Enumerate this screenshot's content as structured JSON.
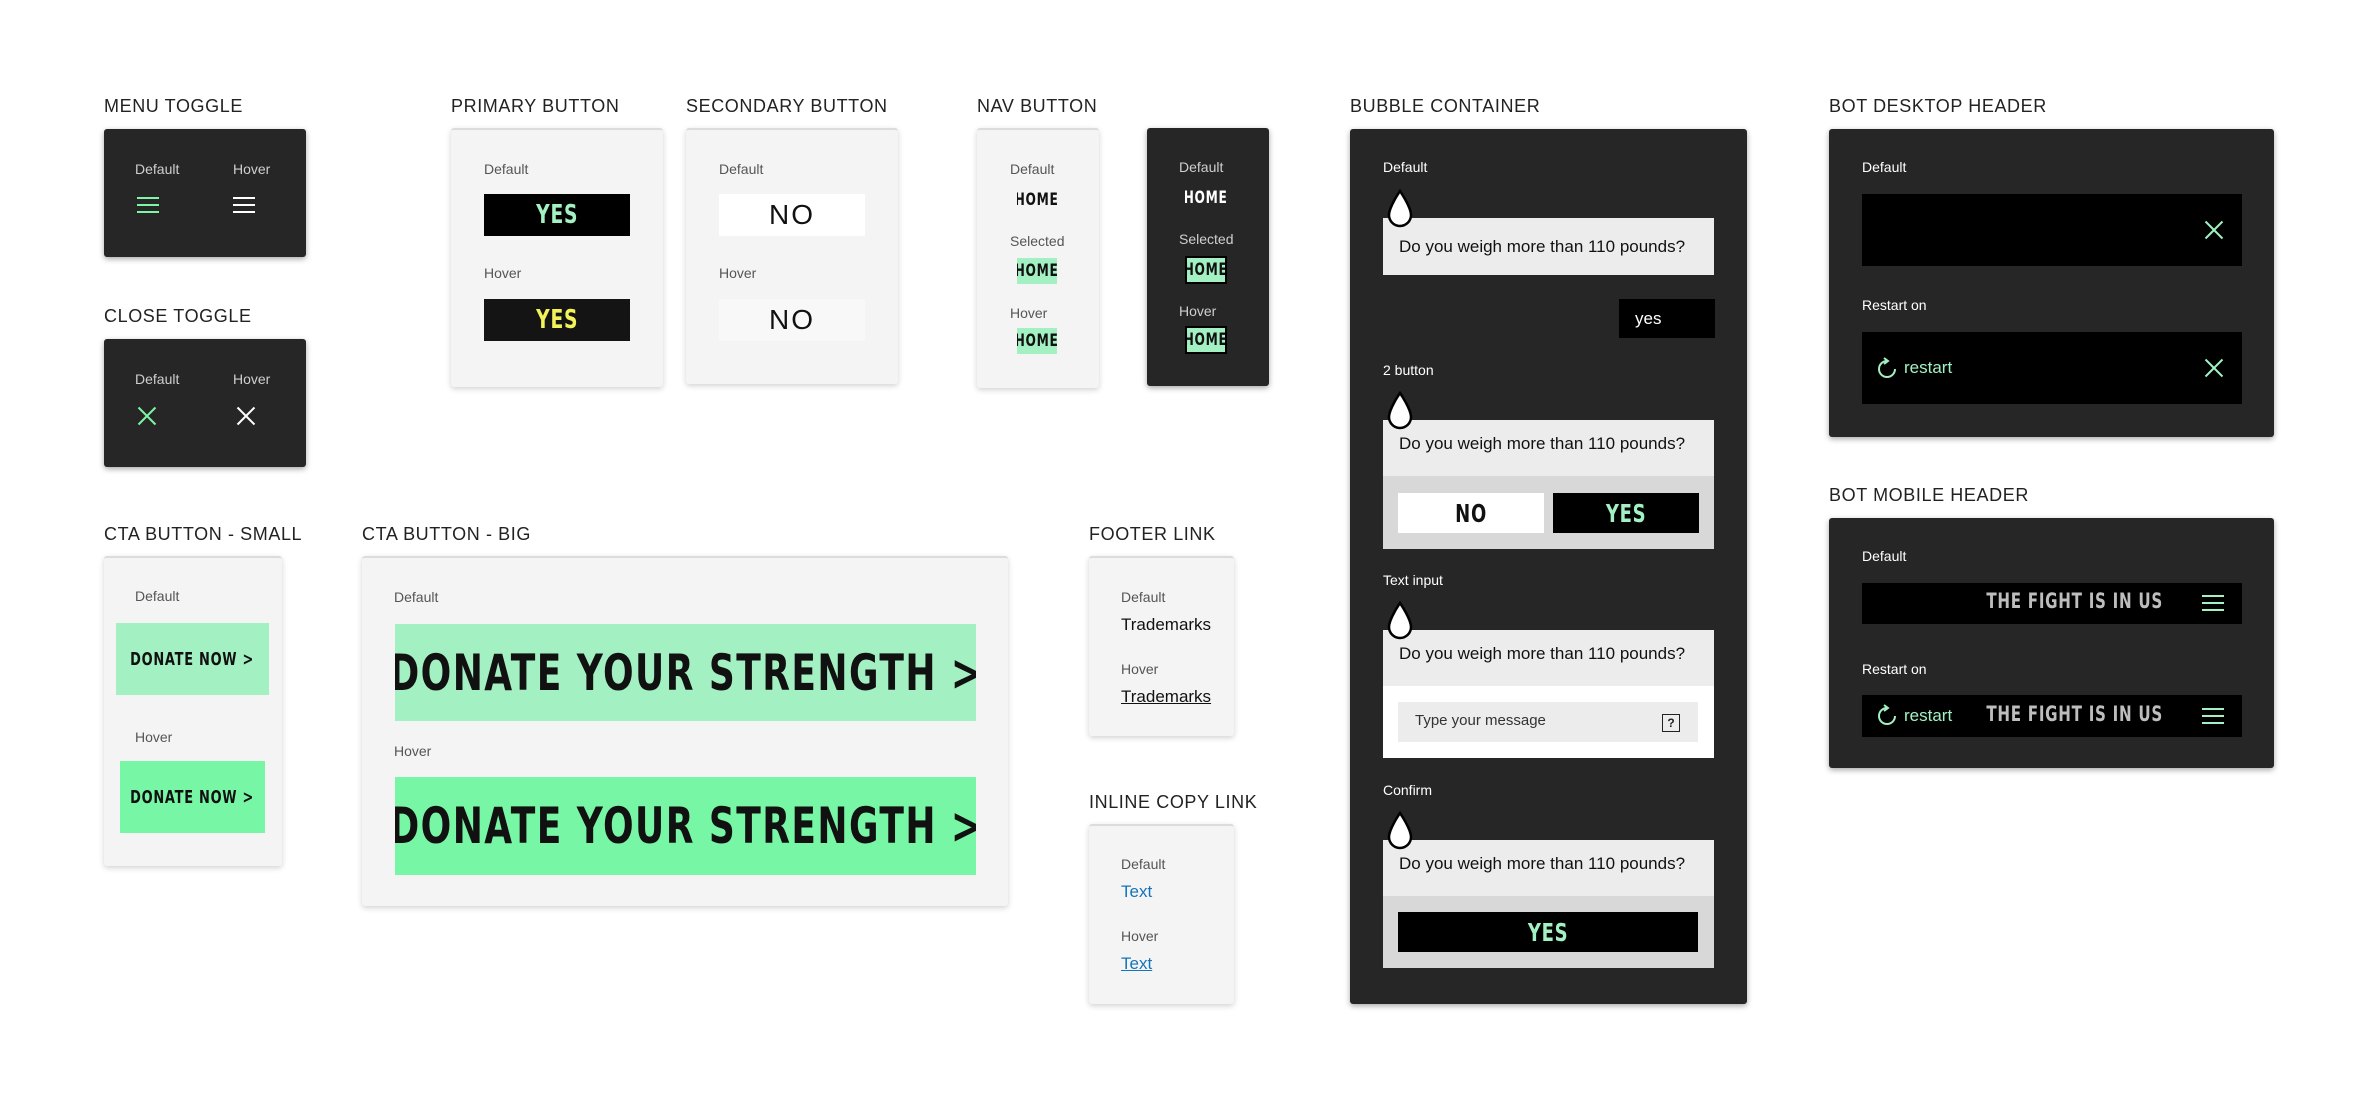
{
  "colors": {
    "dark_bg": "#262626",
    "black": "#000000",
    "mint_accent": "#7df5a6",
    "mint_light": "#a3f1c2",
    "mint_bright": "#77f7a5",
    "yellow": "#f2f25a",
    "link_blue": "#1673b8",
    "light_card": "#f4f4f4"
  },
  "menu_toggle": {
    "title": "MENU TOGGLE",
    "default_label": "Default",
    "hover_label": "Hover",
    "default_icon": "hamburger-icon",
    "hover_icon": "hamburger-icon"
  },
  "close_toggle": {
    "title": "CLOSE TOGGLE",
    "default_label": "Default",
    "hover_label": "Hover",
    "default_icon": "close-icon",
    "hover_icon": "close-icon"
  },
  "primary_button": {
    "title": "PRIMARY BUTTON",
    "default_label": "Default",
    "default_text": "YES",
    "hover_label": "Hover",
    "hover_text": "YES"
  },
  "secondary_button": {
    "title": "SECONDARY BUTTON",
    "default_label": "Default",
    "default_text": "NO",
    "hover_label": "Hover",
    "hover_text": "NO"
  },
  "nav_button": {
    "title": "NAV BUTTON",
    "light": {
      "default_label": "Default",
      "default_text": "HOME",
      "selected_label": "Selected",
      "selected_text": "HOME",
      "hover_label": "Hover",
      "hover_text": "HOME"
    },
    "dark": {
      "default_label": "Default",
      "default_text": "HOME",
      "selected_label": "Selected",
      "selected_text": "HOME",
      "hover_label": "Hover",
      "hover_text": "HOME"
    }
  },
  "bubble_container": {
    "title": "BUBBLE CONTAINER",
    "default_label": "Default",
    "question": "Do you weigh more than 110 pounds?",
    "reply": "yes",
    "two_button_label": "2 button",
    "no_text": "NO",
    "yes_text": "YES",
    "text_input_label": "Text input",
    "input_placeholder": "Type your message",
    "send_icon": "help-icon",
    "confirm_label": "Confirm",
    "confirm_text": "YES",
    "avatar_icon": "drop-icon"
  },
  "bot_desktop_header": {
    "title": "BOT DESKTOP HEADER",
    "default_label": "Default",
    "restart_on_label": "Restart on",
    "restart_text": "restart"
  },
  "bot_mobile_header": {
    "title": "BOT MOBILE HEADER",
    "default_label": "Default",
    "brand_text": "THE FIGHT IS IN US",
    "restart_on_label": "Restart on",
    "restart_text": "restart",
    "brand_text_2": "THE FIGHT IS IN US"
  },
  "cta_small": {
    "title": "CTA BUTTON - SMALL",
    "default_label": "Default",
    "default_text": "DONATE NOW >",
    "hover_label": "Hover",
    "hover_text": "DONATE NOW >"
  },
  "cta_big": {
    "title": "CTA BUTTON - BIG",
    "default_label": "Default",
    "default_text": "DONATE YOUR STRENGTH >",
    "hover_label": "Hover",
    "hover_text": "DONATE YOUR STRENGTH >"
  },
  "footer_link": {
    "title": "FOOTER LINK",
    "default_label": "Default",
    "default_text": "Trademarks",
    "hover_label": "Hover",
    "hover_text": "Trademarks"
  },
  "inline_copy_link": {
    "title": "INLINE COPY LINK",
    "default_label": "Default",
    "default_text": "Text",
    "hover_label": "Hover",
    "hover_text": "Text"
  }
}
